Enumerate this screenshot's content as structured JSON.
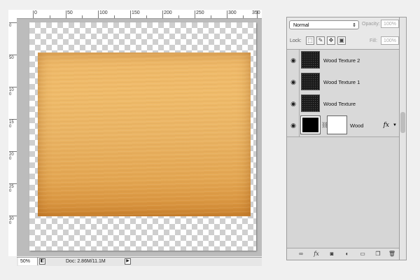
{
  "canvas": {
    "ruler_top_labels": [
      "0",
      "50",
      "100",
      "150",
      "200",
      "250",
      "300",
      "350"
    ],
    "ruler_left_labels": [
      "0",
      "50",
      "100",
      "150",
      "200",
      "250",
      "300"
    ]
  },
  "status_bar": {
    "zoom": "50%",
    "doc_info": "Doc: 2.86M/11.1M"
  },
  "layers_panel": {
    "blend_mode": "Normal",
    "opacity_label": "Opacity:",
    "opacity_value": "100%",
    "lock_label": "Lock:",
    "fill_label": "Fill:",
    "fill_value": "100%",
    "layers": [
      {
        "name": "Wood Texture 2",
        "visible": true
      },
      {
        "name": "Wood Texture 1",
        "visible": true
      },
      {
        "name": "Wood Texture",
        "visible": true
      },
      {
        "name": "Wood",
        "visible": true,
        "has_mask": true,
        "has_effects": true,
        "fx_label": "fx"
      }
    ],
    "footer_icons": [
      "link-layers-icon",
      "fx-icon",
      "layer-mask-icon",
      "adjustment-layer-icon",
      "group-folder-icon",
      "new-layer-icon",
      "trash-icon"
    ]
  },
  "colors": {
    "wood_top": "#eeb868",
    "wood_bottom": "#d48c36",
    "panel_bg": "#d6d6d6"
  }
}
